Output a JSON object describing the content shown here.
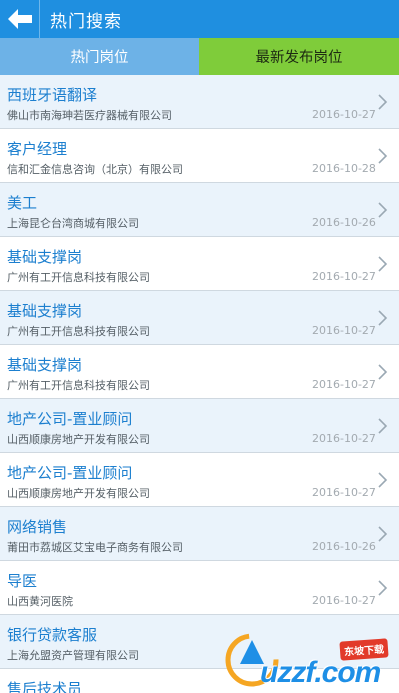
{
  "header": {
    "title": "热门搜索",
    "back_icon": "back-arrow-icon"
  },
  "tabs": [
    {
      "label": "热门岗位",
      "color": "#6db2e7"
    },
    {
      "label": "最新发布岗位",
      "color": "#7fcc3a"
    }
  ],
  "jobs": [
    {
      "title": "西班牙语翻译",
      "company": "佛山市南海珅若医疗器械有限公司",
      "date": "2016-10-27"
    },
    {
      "title": "客户经理",
      "company": "信和汇金信息咨询（北京）有限公司",
      "date": "2016-10-28"
    },
    {
      "title": "美工",
      "company": "上海昆仑台湾商城有限公司",
      "date": "2016-10-26"
    },
    {
      "title": "基础支撑岗",
      "company": "广州有工开信息科技有限公司",
      "date": "2016-10-27"
    },
    {
      "title": "基础支撑岗",
      "company": "广州有工开信息科技有限公司",
      "date": "2016-10-27"
    },
    {
      "title": "基础支撑岗",
      "company": "广州有工开信息科技有限公司",
      "date": "2016-10-27"
    },
    {
      "title": "地产公司-置业顾问",
      "company": "山西顺康房地产开发有限公司",
      "date": "2016-10-27"
    },
    {
      "title": "地产公司-置业顾问",
      "company": "山西顺康房地产开发有限公司",
      "date": "2016-10-27"
    },
    {
      "title": "网络销售",
      "company": "莆田市荔城区艾宝电子商务有限公司",
      "date": "2016-10-26"
    },
    {
      "title": "导医",
      "company": "山西黄河医院",
      "date": "2016-10-27"
    },
    {
      "title": "银行贷款客服",
      "company": "上海允盟资产管理有限公司",
      "date": ""
    },
    {
      "title": "售后技术员",
      "company": "",
      "date": ""
    }
  ],
  "watermark": {
    "text": "uzzf.com",
    "badge": "东坡下载"
  },
  "colors": {
    "header": "#1f8fe0",
    "title_text": "#1c7fcf",
    "row_alt": "#eaf3fb"
  }
}
